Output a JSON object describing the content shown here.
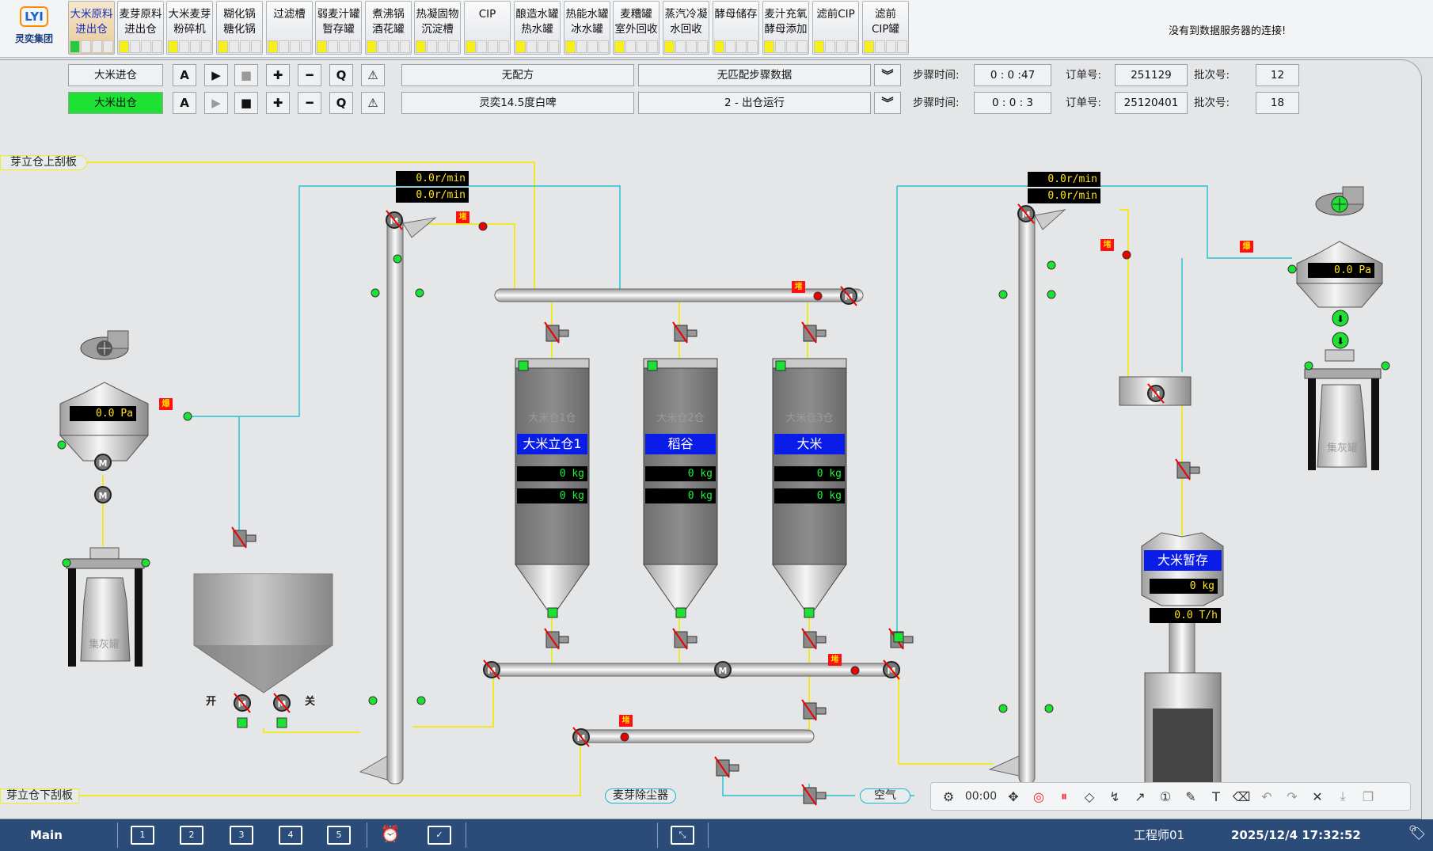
{
  "app": {
    "logo_text": "灵奕集团",
    "logo_mark": "LYI",
    "connection_status": "没有到数据服务器的连接!"
  },
  "nav": [
    {
      "label": "大米原料\n进出仓",
      "active": true
    },
    {
      "label": "麦芽原料\n进出仓"
    },
    {
      "label": "大米麦芽\n粉碎机"
    },
    {
      "label": "糊化锅\n糖化锅"
    },
    {
      "label": "过滤槽"
    },
    {
      "label": "弱麦汁罐\n暂存罐"
    },
    {
      "label": "煮沸锅\n酒花罐"
    },
    {
      "label": "热凝固物\n沉淀槽"
    },
    {
      "label": "CIP"
    },
    {
      "label": "酿造水罐\n热水罐"
    },
    {
      "label": "热能水罐\n冰水罐"
    },
    {
      "label": "麦糟罐\n室外回收"
    },
    {
      "label": "蒸汽冷凝\n水回收"
    },
    {
      "label": "酵母储存"
    },
    {
      "label": "麦汁充氧\n酵母添加"
    },
    {
      "label": "滤前CIP"
    },
    {
      "label": "滤前\nCIP罐"
    }
  ],
  "control_rows": [
    {
      "name": "大米进仓",
      "active": false,
      "mode": "A",
      "recipe": "无配方",
      "step": "无匹配步骤数据",
      "step_time_label": "步骤时间:",
      "step_time": "0 : 0 :47",
      "order_label": "订单号:",
      "order": "251129",
      "batch_label": "批次号:",
      "batch": "12"
    },
    {
      "name": "大米出仓",
      "active": true,
      "mode": "A",
      "recipe": "灵奕14.5度白啤",
      "step": "2 - 出仓运行",
      "step_time_label": "步骤时间:",
      "step_time": "0 : 0 : 3",
      "order_label": "订单号:",
      "order": "25120401",
      "batch_label": "批次号:",
      "batch": "18"
    }
  ],
  "control_icons": {
    "play": "play-icon",
    "stop": "stop-icon",
    "plus": "plus-icon",
    "minus": "minus-icon",
    "q": "Q",
    "alarm": "warning-icon",
    "expand": "double-chevron-down-icon"
  },
  "process": {
    "top_left_label": "芽立仓上刮板",
    "bottom_left_label": "芽立仓下刮板",
    "dust_collector": "麦芽除尘器",
    "air": "空气",
    "elev1_speed1": "0.0r/min",
    "elev1_speed2": "0.0r/min",
    "elev2_speed1": "0.0r/min",
    "elev2_speed2": "0.0r/min",
    "filter_left_pressure": "0.0 Pa",
    "filter_right_pressure": "0.0 Pa",
    "dust_bin_left": "集灰罐",
    "dust_bin_right": "集灰罐",
    "valve_open": "开",
    "valve_close": "关",
    "warn_block": "堵",
    "warn_explode": "爆",
    "silos": [
      {
        "title": "大米仓1仓",
        "content": "大米立仓1",
        "weight1": "0  kg",
        "weight2": "0  kg"
      },
      {
        "title": "大米仓2仓",
        "content": "稻谷",
        "weight1": "0  kg",
        "weight2": "0  kg"
      },
      {
        "title": "大米仓3仓",
        "content": "大米",
        "weight1": "0  kg",
        "weight2": "0  kg"
      }
    ],
    "temp_bin": {
      "title": "大米暂存",
      "weight": "0  kg",
      "flow": "0.0 T/h"
    }
  },
  "annot_toolbar": {
    "timer": "00:00"
  },
  "taskbar": {
    "main": "Main",
    "screens": [
      "1",
      "2",
      "3",
      "4",
      "5"
    ],
    "user": "工程师01",
    "datetime": "2025/12/4 17:32:52"
  },
  "colors": {
    "nav_active": "#e8c996",
    "green": "#1ee233",
    "blue_box": "#0a1de8",
    "pipe_yellow": "#f2e82a",
    "pipe_cyan": "#27c3d6",
    "taskbar": "#2b4b78",
    "warn_red": "#ff1010"
  }
}
